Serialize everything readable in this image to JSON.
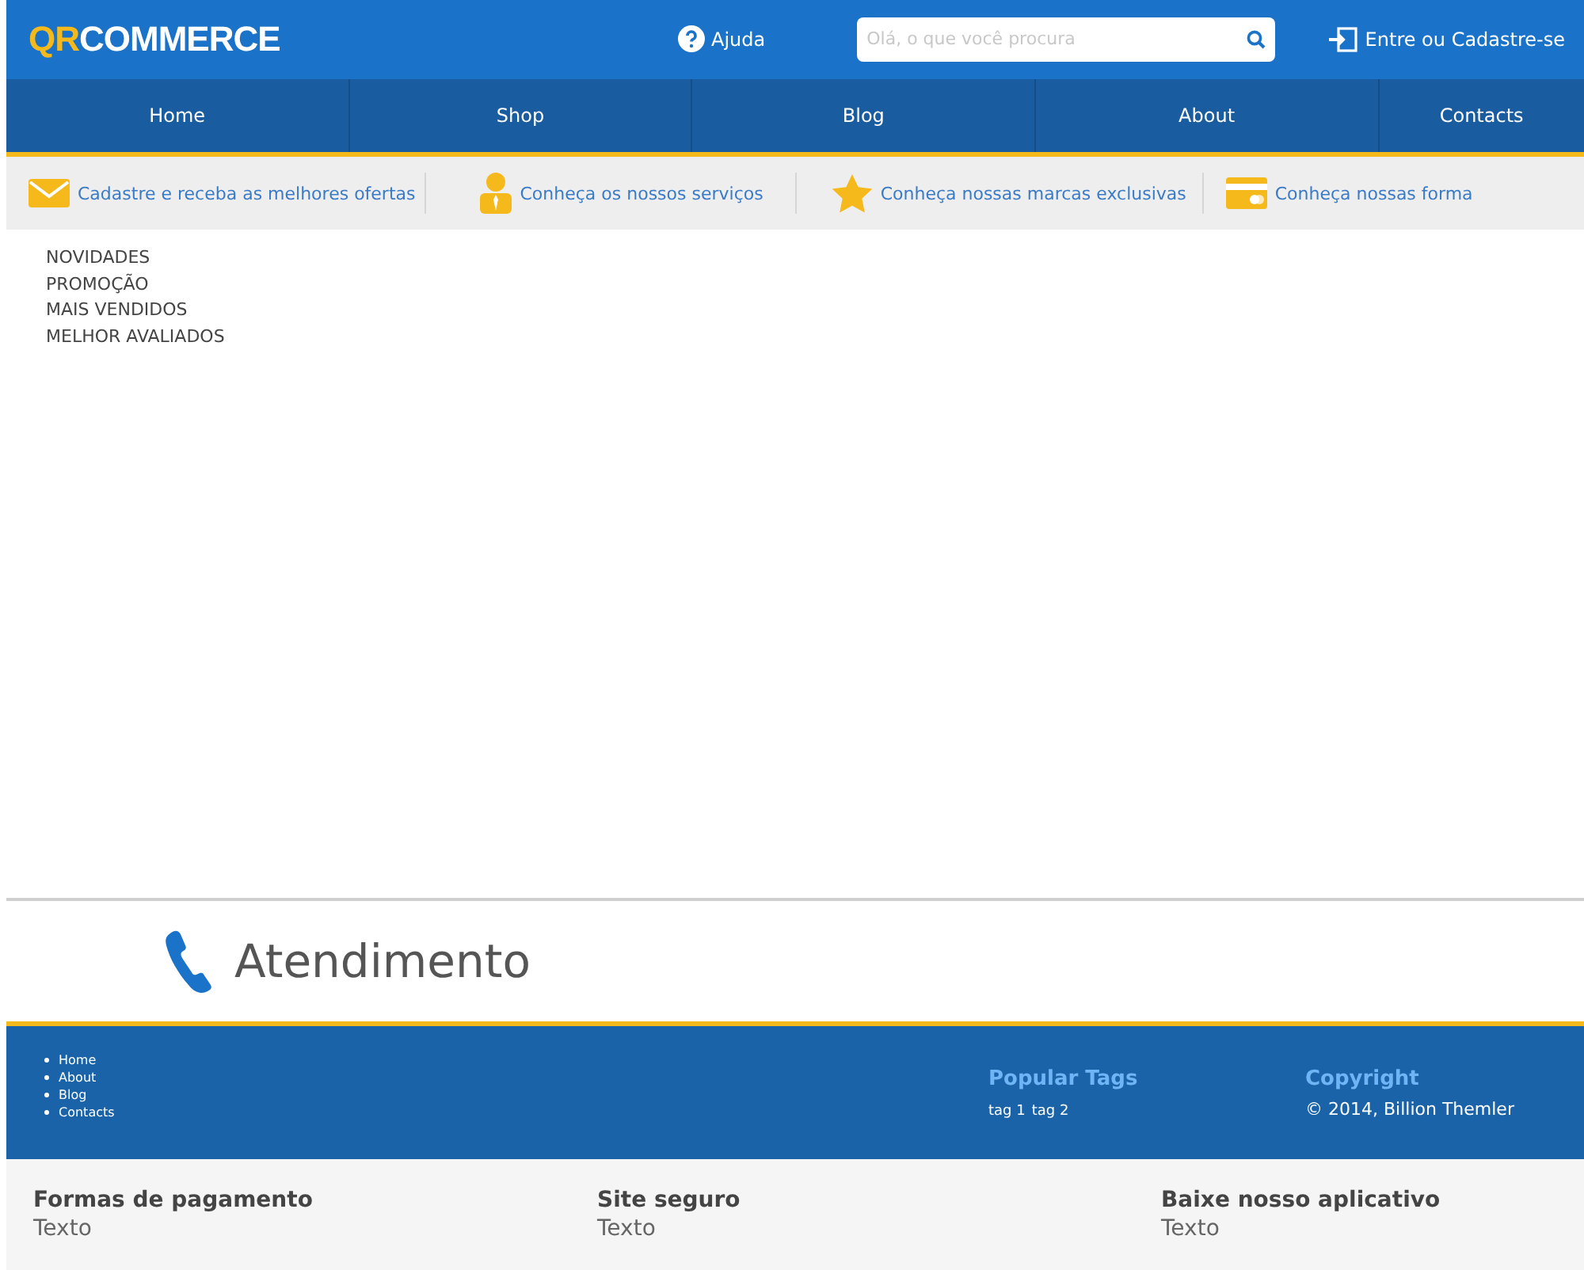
{
  "header": {
    "logo_accent": "QR",
    "logo_text": "COMMERCE",
    "help": "Ajuda",
    "search": {
      "placeholder": "Olá, o que você procura"
    },
    "login": "Entre ou Cadastre-se"
  },
  "nav": [
    {
      "label": "Home",
      "selected": false
    },
    {
      "label": "Shop",
      "selected": false
    },
    {
      "label": "Blog",
      "selected": false
    },
    {
      "label": "About",
      "selected": false
    },
    {
      "label": "Contacts",
      "selected": false
    }
  ],
  "features": [
    {
      "kind": "mail",
      "label": "Cadastre e receba as melhores ofertas"
    },
    {
      "kind": "person",
      "label": "Conheça os nossos serviços"
    },
    {
      "kind": "star",
      "label": "Conheça nossas marcas exclusivas"
    },
    {
      "kind": "card",
      "label": "Conheça nossas forma"
    }
  ],
  "categories": [
    "NOVIDADES",
    "PROMOÇÃO",
    "MAIS VENDIDOS",
    "MELHOR AVALIADOS"
  ],
  "support": {
    "title": "Atendimento"
  },
  "footer": {
    "links": [
      "Home",
      "About",
      "Blog",
      "Contacts"
    ],
    "tags_title": "Popular Tags",
    "tags": [
      "tag 1",
      "tag 2"
    ],
    "copyright_title": "Copyright",
    "copyright": "© 2014, Billion Themler"
  },
  "bottom": [
    {
      "title": "Formas de pagamento",
      "text": "Texto"
    },
    {
      "title": "Site seguro",
      "text": "Texto"
    },
    {
      "title": "Baixe nosso aplicativo",
      "text": "Texto"
    }
  ]
}
